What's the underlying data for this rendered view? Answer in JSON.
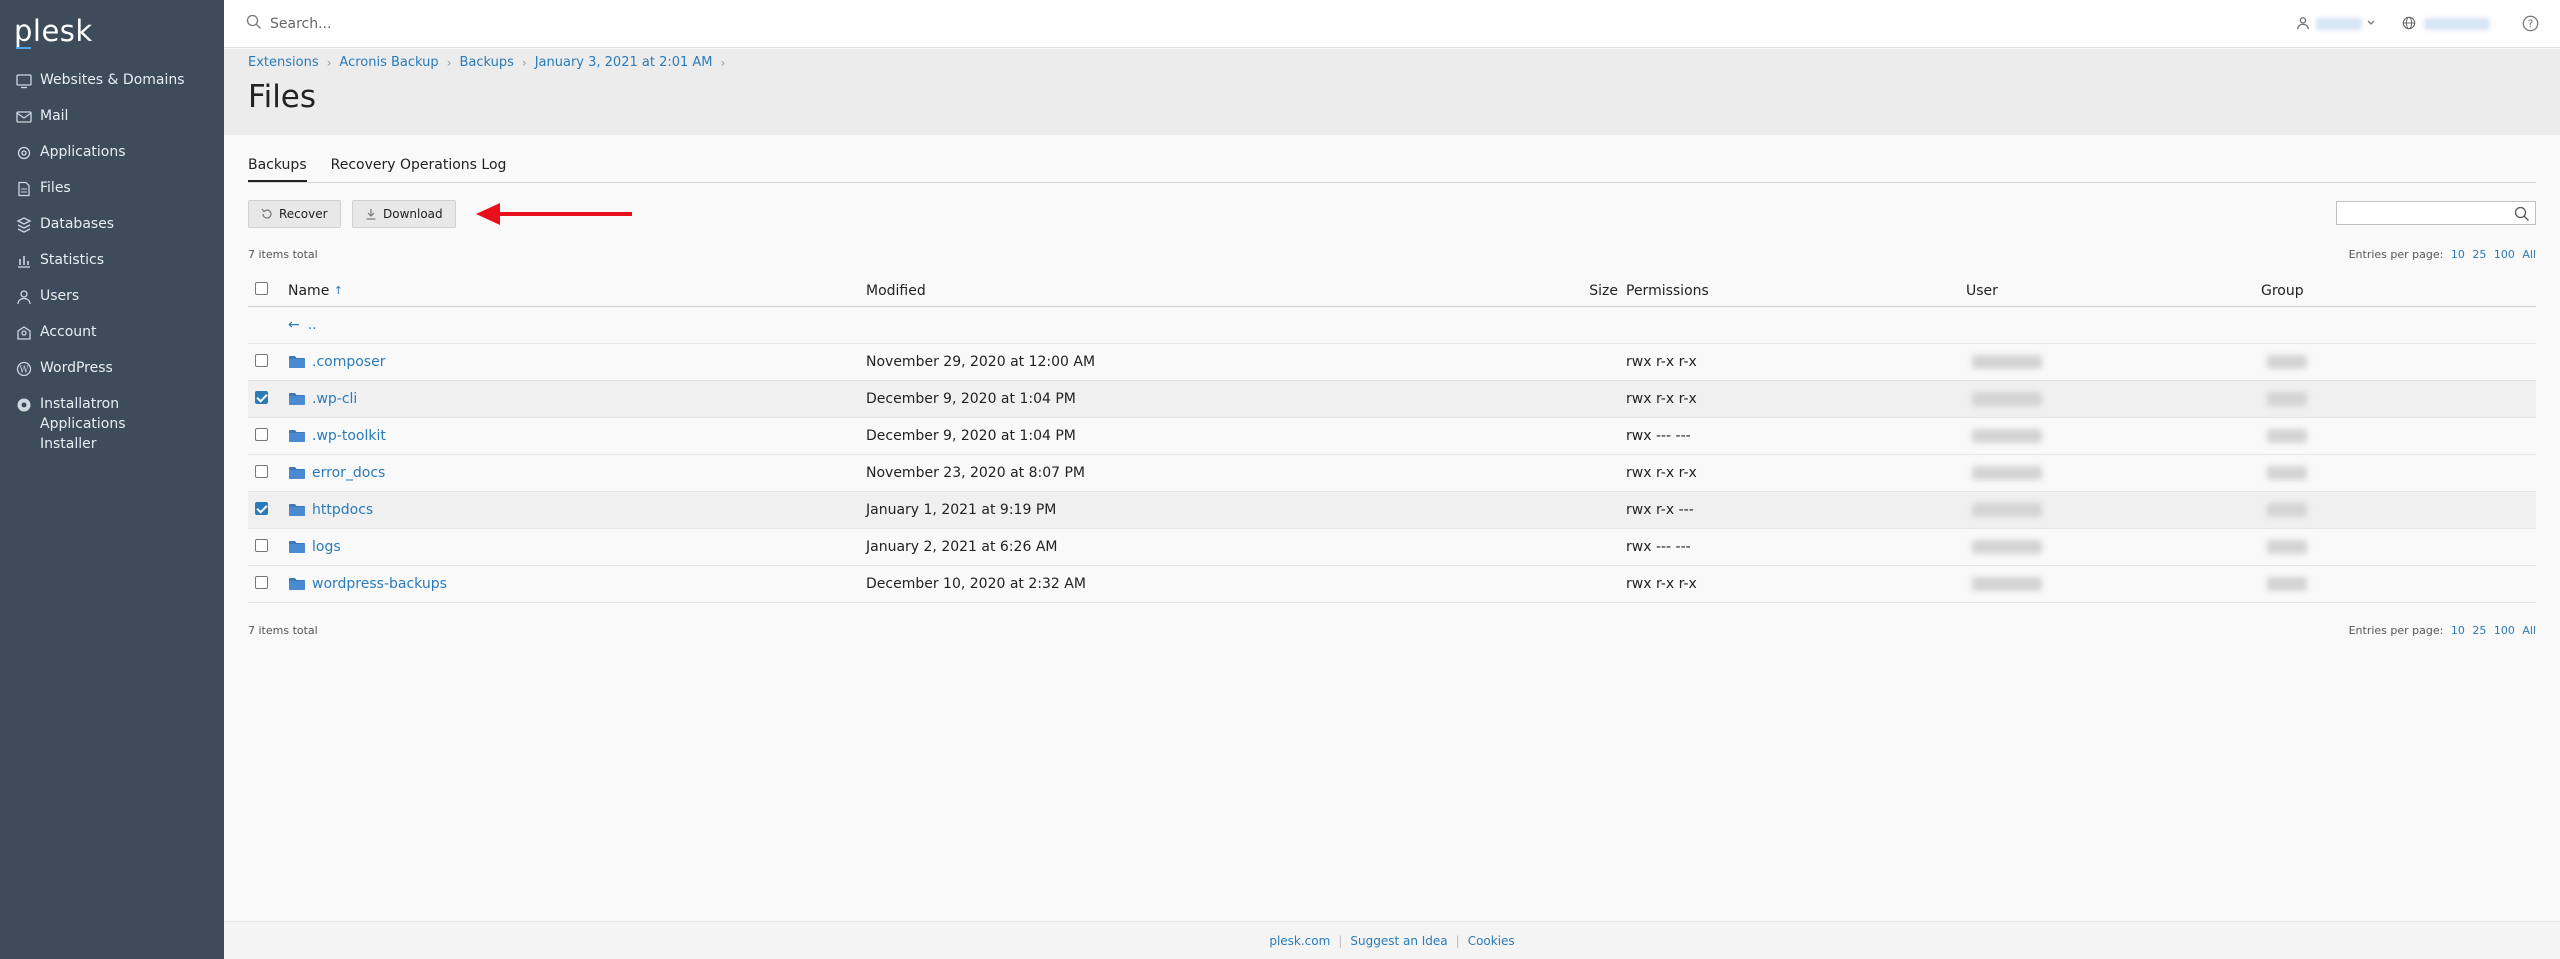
{
  "app": {
    "logo": "plesk"
  },
  "sidebar": {
    "items": [
      {
        "label": "Websites & Domains",
        "icon": "monitor-icon"
      },
      {
        "label": "Mail",
        "icon": "mail-icon"
      },
      {
        "label": "Applications",
        "icon": "gear-icon"
      },
      {
        "label": "Files",
        "icon": "file-icon"
      },
      {
        "label": "Databases",
        "icon": "database-icon"
      },
      {
        "label": "Statistics",
        "icon": "chart-icon"
      },
      {
        "label": "Users",
        "icon": "user-icon"
      },
      {
        "label": "Account",
        "icon": "account-icon"
      },
      {
        "label": "WordPress",
        "icon": "wordpress-icon"
      },
      {
        "label": "Installatron Applications",
        "label2": "Installer",
        "icon": "installatron-icon"
      }
    ]
  },
  "search": {
    "placeholder": "Search..."
  },
  "breadcrumb": [
    "Extensions",
    "Acronis Backup",
    "Backups",
    "January 3, 2021 at 2:01 AM"
  ],
  "page": {
    "title": "Files"
  },
  "tabs": [
    {
      "label": "Backups",
      "active": true
    },
    {
      "label": "Recovery Operations Log",
      "active": false
    }
  ],
  "toolbar": {
    "recover_label": "Recover",
    "download_label": "Download"
  },
  "list": {
    "total_top": "7 items total",
    "total_bottom": "7 items total",
    "entries_label": "Entries per page:",
    "entries_options": [
      "10",
      "25",
      "100",
      "All"
    ],
    "columns": {
      "name": "Name",
      "sort_arrow": "↑",
      "modified": "Modified",
      "size": "Size",
      "permissions": "Permissions",
      "user": "User",
      "group": "Group"
    },
    "up_label": "..",
    "rows": [
      {
        "name": ".composer",
        "modified": "November 29, 2020 at 12:00 AM",
        "permissions": "rwx r-x r-x",
        "checked": false
      },
      {
        "name": ".wp-cli",
        "modified": "December 9, 2020 at 1:04 PM",
        "permissions": "rwx r-x r-x",
        "checked": true
      },
      {
        "name": ".wp-toolkit",
        "modified": "December 9, 2020 at 1:04 PM",
        "permissions": "rwx --- ---",
        "checked": false
      },
      {
        "name": "error_docs",
        "modified": "November 23, 2020 at 8:07 PM",
        "permissions": "rwx r-x r-x",
        "checked": false
      },
      {
        "name": "httpdocs",
        "modified": "January 1, 2021 at 9:19 PM",
        "permissions": "rwx r-x ---",
        "checked": true
      },
      {
        "name": "logs",
        "modified": "January 2, 2021 at 6:26 AM",
        "permissions": "rwx --- ---",
        "checked": false
      },
      {
        "name": "wordpress-backups",
        "modified": "December 10, 2020 at 2:32 AM",
        "permissions": "rwx r-x r-x",
        "checked": false
      }
    ]
  },
  "footer": {
    "links": [
      "plesk.com",
      "Suggest an Idea",
      "Cookies"
    ]
  },
  "colors": {
    "sidebar": "#3e4b5b",
    "link": "#2a7bb8",
    "annotation_arrow": "#e8101a"
  }
}
